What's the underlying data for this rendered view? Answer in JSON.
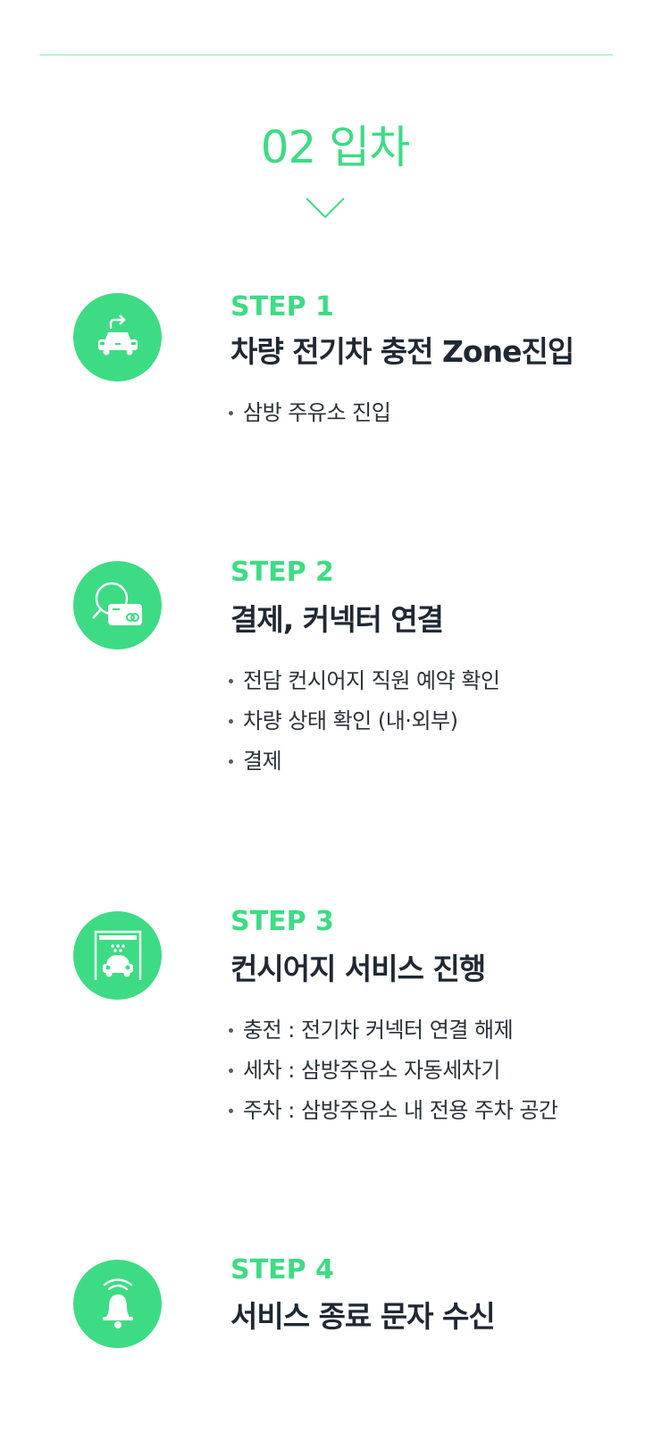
{
  "header": {
    "title": "02 입차"
  },
  "colors": {
    "accent": "#3ddc84",
    "text": "#1f2833"
  },
  "steps": [
    {
      "label": "STEP 1",
      "title": "차량 전기차 충전 Zone진입",
      "icon": "car-entry-icon",
      "bullets": [
        "삼방 주유소 진입"
      ]
    },
    {
      "label": "STEP 2",
      "title": "결제, 커넥터 연결",
      "icon": "payment-card-icon",
      "bullets": [
        "전담 컨시어지 직원 예약 확인",
        "차량 상태 확인 (내·외부)",
        "결제"
      ]
    },
    {
      "label": "STEP 3",
      "title": "컨시어지 서비스 진행",
      "icon": "car-wash-icon",
      "bullets": [
        "충전 : 전기차 커넥터 연결 해제",
        "세차 : 삼방주유소 자동세차기",
        "주차 : 삼방주유소 내 전용 주차 공간"
      ]
    },
    {
      "label": "STEP 4",
      "title": "서비스 종료 문자 수신",
      "icon": "bell-icon",
      "bullets": []
    }
  ]
}
